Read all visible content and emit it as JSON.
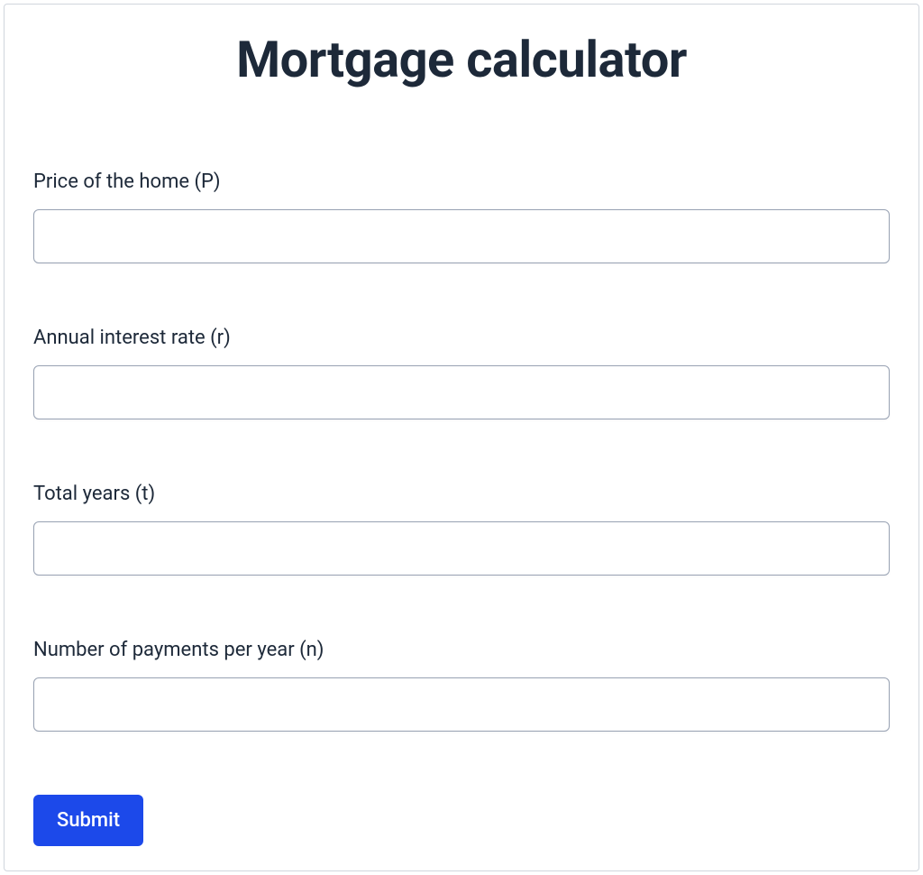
{
  "title": "Mortgage calculator",
  "fields": {
    "price": {
      "label": "Price of the home (P)",
      "value": ""
    },
    "rate": {
      "label": "Annual interest rate (r)",
      "value": ""
    },
    "years": {
      "label": "Total years (t)",
      "value": ""
    },
    "payments": {
      "label": "Number of payments per year (n)",
      "value": ""
    }
  },
  "submit_label": "Submit"
}
